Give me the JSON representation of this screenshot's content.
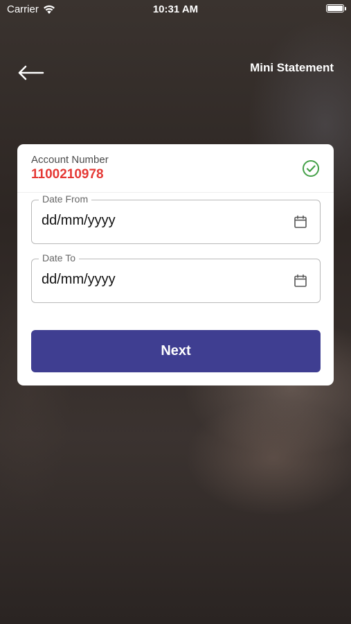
{
  "status_bar": {
    "carrier": "Carrier",
    "time": "10:31 AM"
  },
  "nav": {
    "title": "Mini Statement",
    "back_icon": "back-arrow-icon"
  },
  "account": {
    "label": "Account Number",
    "number": "1100210978",
    "number_color": "#e53935",
    "verified_icon": "check-circle-icon",
    "verified_color": "#43a047"
  },
  "date_from": {
    "label": "Date From",
    "placeholder": "dd/mm/yyyy",
    "icon": "calendar-icon"
  },
  "date_to": {
    "label": "Date To",
    "placeholder": "dd/mm/yyyy",
    "icon": "calendar-icon"
  },
  "next_button": {
    "label": "Next",
    "color": "#3f3e91"
  }
}
